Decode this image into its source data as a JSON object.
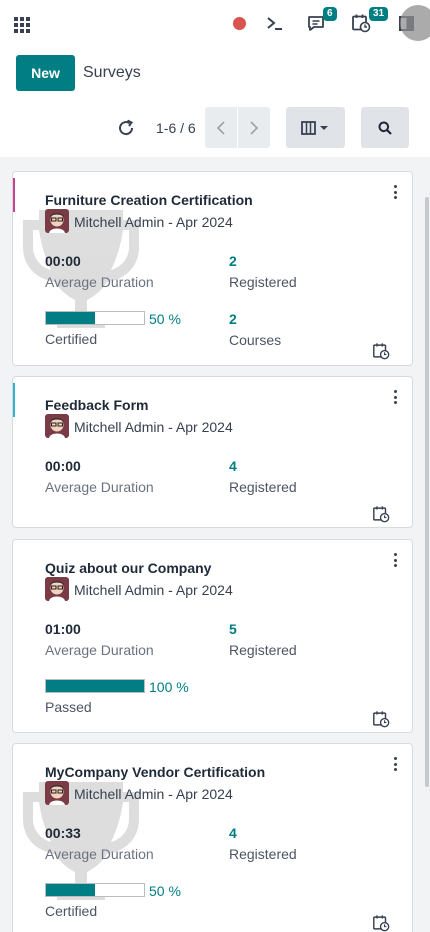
{
  "topbar": {
    "chat_badge": "6",
    "activity_badge": "31"
  },
  "control": {
    "new_label": "New",
    "title": "Surveys",
    "pager": "1-6 / 6"
  },
  "cards": [
    {
      "title": "Furniture Creation Certification",
      "author": "Mitchell Admin - Apr 2024",
      "duration_value": "00:00",
      "duration_label": "Average Duration",
      "registered_value": "2",
      "registered_label": "Registered",
      "progress_value": "50 %",
      "progress_fraction": 0.5,
      "progress_label": "Certified",
      "courses_value": "2",
      "courses_label": "Courses"
    },
    {
      "title": "Feedback Form",
      "author": "Mitchell Admin - Apr 2024",
      "duration_value": "00:00",
      "duration_label": "Average Duration",
      "registered_value": "4",
      "registered_label": "Registered"
    },
    {
      "title": "Quiz about our Company",
      "author": "Mitchell Admin - Apr 2024",
      "duration_value": "01:00",
      "duration_label": "Average Duration",
      "registered_value": "5",
      "registered_label": "Registered",
      "progress_value": "100 %",
      "progress_fraction": 1.0,
      "progress_label": "Passed"
    },
    {
      "title": "MyCompany Vendor Certification",
      "author": "Mitchell Admin - Apr 2024",
      "duration_value": "00:33",
      "duration_label": "Average Duration",
      "registered_value": "4",
      "registered_label": "Registered",
      "progress_value": "50 %",
      "progress_fraction": 0.5,
      "progress_label": "Certified"
    }
  ],
  "colors": {
    "accent": "#017e84",
    "stripe_pink": "#c8438f",
    "stripe_cyan": "#29b6d6",
    "record_red": "#d9534f"
  },
  "icons": [
    "apps-icon",
    "record-icon",
    "terminal-icon",
    "chat-icon",
    "activity-icon",
    "theme-switch-icon",
    "refresh-icon",
    "chevron-left-icon",
    "chevron-right-icon",
    "columns-view-icon",
    "search-icon",
    "kebab-menu-icon",
    "trophy-icon",
    "calendar-clock-icon",
    "avatar"
  ]
}
